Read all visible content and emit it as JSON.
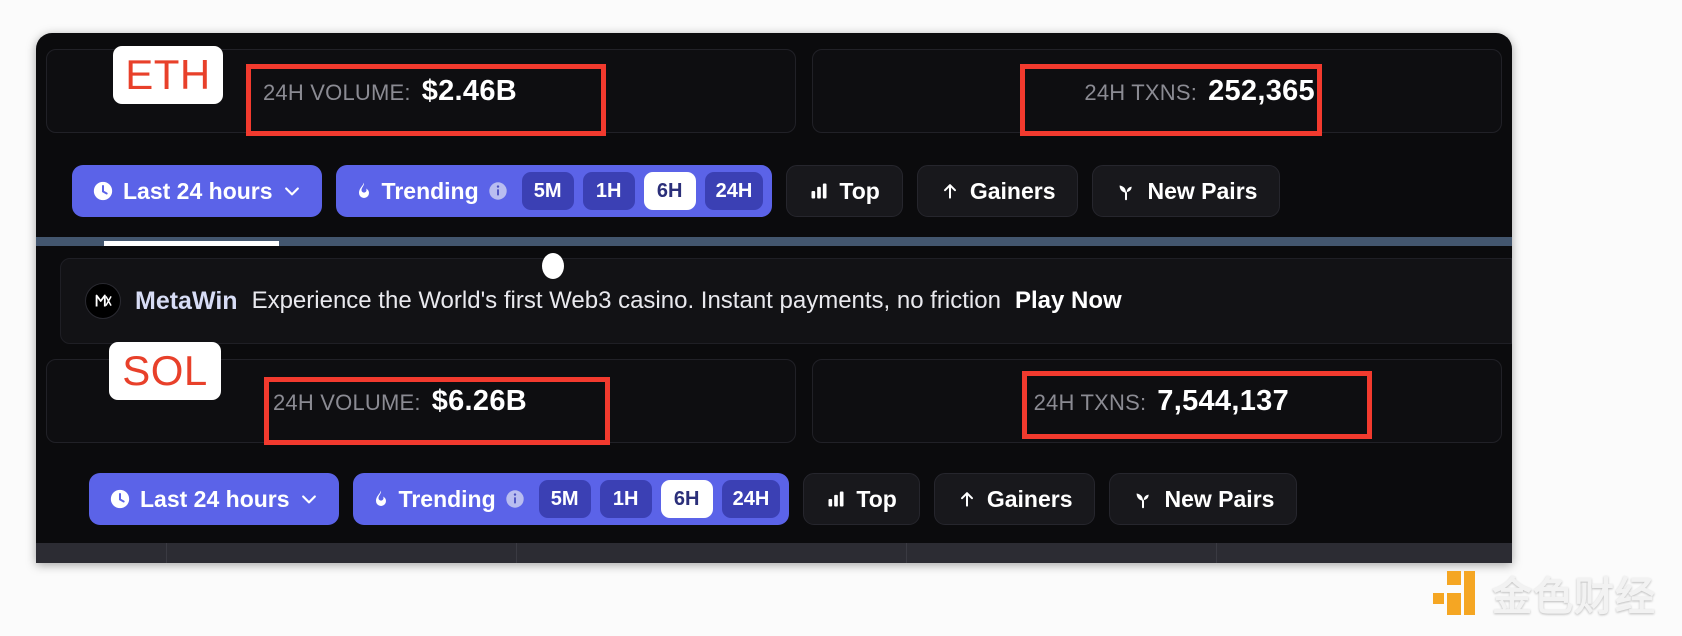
{
  "chains": [
    {
      "symbol": "ETH",
      "volume_label": "24H VOLUME:",
      "volume_value": "$2.46B",
      "txns_label": "24H TXNS:",
      "txns_value": "252,365"
    },
    {
      "symbol": "SOL",
      "volume_label": "24H VOLUME:",
      "volume_value": "$6.26B",
      "txns_label": "24H TXNS:",
      "txns_value": "7,544,137"
    }
  ],
  "toolbar": {
    "timeframe_label": "Last 24 hours",
    "trending_label": "Trending",
    "pills": [
      "5M",
      "1H",
      "6H",
      "24H"
    ],
    "active_pill": "6H",
    "top_label": "Top",
    "gainers_label": "Gainers",
    "new_pairs_label": "New Pairs"
  },
  "promo": {
    "brand": "MetaWin",
    "text": "Experience the World's first Web3 casino. Instant payments, no friction",
    "cta": "Play Now"
  },
  "watermark": {
    "text": "金色财经"
  },
  "colors": {
    "accent_purple": "#5b63e8",
    "pill_purple": "#3b40b4",
    "annotation_red": "#f23a2e",
    "chain_red": "#e8402a",
    "panel_bg": "#0e0e11",
    "window_bg": "#0b0b0d",
    "watermark_orange": "#f5a623"
  }
}
